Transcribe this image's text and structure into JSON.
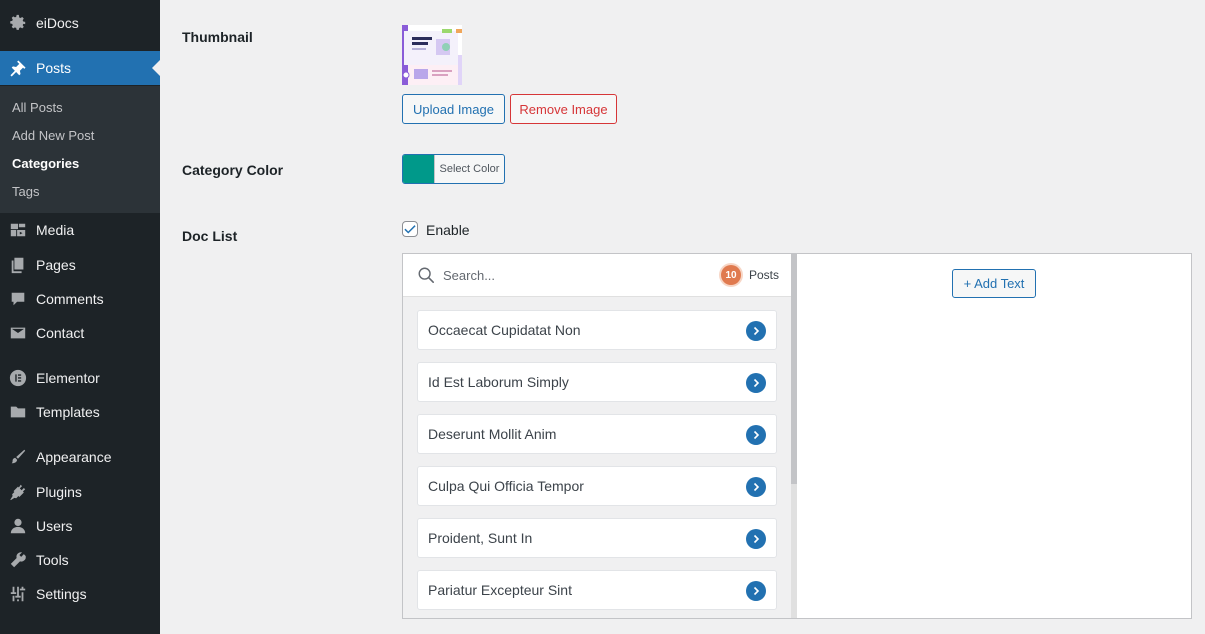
{
  "sidebar": {
    "site_name": "eiDocs",
    "menu": [
      {
        "label": "Posts",
        "icon": "pin-icon",
        "active": true
      },
      {
        "label": "Media",
        "icon": "media-icon"
      },
      {
        "label": "Pages",
        "icon": "pages-icon"
      },
      {
        "label": "Comments",
        "icon": "comments-icon"
      },
      {
        "label": "Contact",
        "icon": "envelope-icon"
      },
      {
        "label": "Elementor",
        "icon": "elementor-icon"
      },
      {
        "label": "Templates",
        "icon": "folder-icon"
      },
      {
        "label": "Appearance",
        "icon": "brush-icon"
      },
      {
        "label": "Plugins",
        "icon": "plug-icon"
      },
      {
        "label": "Users",
        "icon": "user-icon"
      },
      {
        "label": "Tools",
        "icon": "wrench-icon"
      },
      {
        "label": "Settings",
        "icon": "sliders-icon"
      }
    ],
    "submenu": [
      {
        "label": "All Posts"
      },
      {
        "label": "Add New Post"
      },
      {
        "label": "Categories",
        "current": true
      },
      {
        "label": "Tags"
      }
    ]
  },
  "form": {
    "thumbnail_label": "Thumbnail",
    "upload_button": "Upload Image",
    "remove_button": "Remove Image",
    "category_color_label": "Category Color",
    "color_value": "#00998a",
    "select_color": "Select Color",
    "doc_list_label": "Doc List",
    "enable_label": "Enable",
    "enable_checked": true
  },
  "doc_list": {
    "search_placeholder": "Search...",
    "post_count": "10",
    "posts_label": "Posts",
    "posts": [
      "Occaecat Cupidatat Non",
      "Id Est Laborum Simply",
      "Deserunt Mollit Anim",
      "Culpa Qui Officia Tempor",
      "Proident, Sunt In",
      "Pariatur Excepteur Sint"
    ],
    "add_text_button": "+ Add Text"
  },
  "colors": {
    "sidebar_bg": "#1d2327",
    "accent": "#2271b1",
    "danger": "#d63638",
    "badge": "#e07a4f"
  }
}
